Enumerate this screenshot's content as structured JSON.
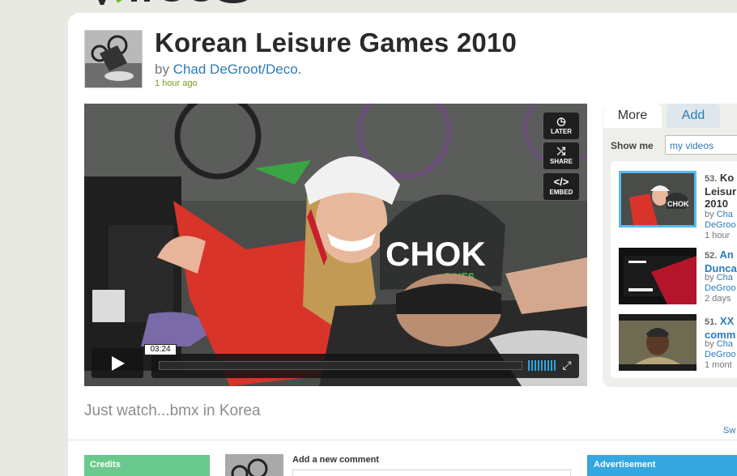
{
  "video": {
    "title": "Korean Leisure Games 2010",
    "by_prefix": "by ",
    "author": "Chad DeGroot/Deco.",
    "time_ago": "1 hour ago",
    "description": "Just watch...bmx in Korea"
  },
  "player": {
    "later_label": "LATER",
    "share_label": "SHARE",
    "embed_label": "EMBED",
    "duration": "03:24",
    "progress": 0.0
  },
  "sidebar": {
    "tabs": [
      "More",
      "Add"
    ],
    "show_me_label": "Show me",
    "show_me_value": "my videos",
    "items": [
      {
        "num": "53.",
        "title_lines": [
          "Ko",
          "Leisur",
          "2010"
        ],
        "by": "by",
        "author_lines": [
          "Cha",
          "DeGroo"
        ],
        "time": "1 hour"
      },
      {
        "num": "52.",
        "title_lines": [
          "An",
          "Dunca"
        ],
        "by": "by",
        "author_lines": [
          "Cha",
          "DeGroo"
        ],
        "time": "2 days"
      },
      {
        "num": "51.",
        "title_lines": [
          "XX",
          "comm"
        ],
        "by": "by",
        "author_lines": [
          "Cha",
          "DeGroo"
        ],
        "time": "1 mont"
      }
    ]
  },
  "swatch_link": "Sw",
  "bottom": {
    "credits_label": "Credits",
    "add_comment_label": "Add a new comment",
    "advertisement_label": "Advertisement"
  },
  "colors": {
    "link": "#2b7bb9",
    "credits": "#69c98c",
    "advertisement": "#34a6e0",
    "time_ago": "#7a9a1e"
  }
}
